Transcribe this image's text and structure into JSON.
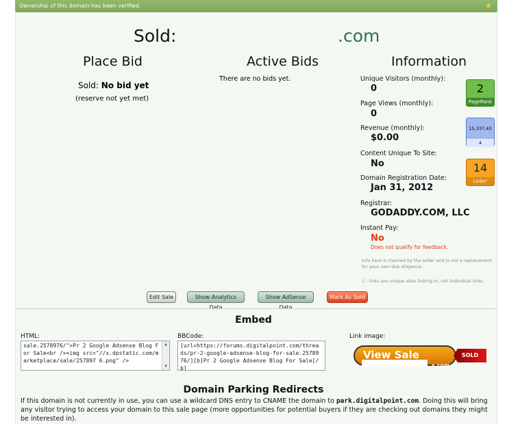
{
  "notice": "Ownership of this domain has been verified.",
  "title": {
    "label": "Sold:",
    "domain": ".com"
  },
  "place_bid": {
    "heading": "Place Bid",
    "status_prefix": "Sold:",
    "status_value": "No bid yet",
    "reserve": "(reserve not yet met)"
  },
  "active_bids": {
    "heading": "Active Bids",
    "empty": "There are no bids yet."
  },
  "information": {
    "heading": "Information",
    "rows": [
      {
        "label": "Unique Visitors (monthly):",
        "value": "0"
      },
      {
        "label": "Page Views (monthly):",
        "value": "0"
      },
      {
        "label": "Revenue (monthly):",
        "value": "$0.00"
      },
      {
        "label": "Content Unique To Site:",
        "value": "No"
      },
      {
        "label": "Domain Registration Date:",
        "value": "Jan 31, 2012"
      },
      {
        "label": "Registrar:",
        "value": "GODADDY.COM, LLC"
      },
      {
        "label": "Instant Pay:",
        "value": "No",
        "note": "Does not qualify for feedback."
      }
    ],
    "disclaimer": "Info here is claimed by the seller and is not a replacement for your own due diligence.",
    "footnote": "1 - links are unique sites linking in, not individual links."
  },
  "badges": {
    "pagerank": {
      "value": "2",
      "caption": "PageRank"
    },
    "alexa": {
      "value": "15,337,43",
      "caption": "4"
    },
    "links": {
      "value": "14",
      "caption": "Links¹"
    }
  },
  "buttons": {
    "edit": "Edit Sale",
    "analytics": "Show Analytics Data",
    "adsense": "Show AdSense Data",
    "mark_sold": "Mark As Sold"
  },
  "embed": {
    "heading": "Embed",
    "html_label": "HTML:",
    "html_code": "sale.2578976/\">Pr 2 Google Adsense Blog For Sale<br /><img src=\"//x.dpstatic.com/marketplace/sale/257897 6.png\" />",
    "bbcode_label": "BBCode:",
    "bbcode_code": "[url=https://forums.digitalpoint.com/threads/pr-2-google-adsense-blog-for-sale.2578976/][b]Pr 2 Google Adsense Blog For Sale[/b]",
    "link_label": "Link image:",
    "view_sale": "View Sale",
    "view_sale_domain": "s.com",
    "sold_tag": "SOLD"
  },
  "parking": {
    "heading": "Domain Parking Redirects",
    "text_before": "If this domain is not currently in use, you can use a wildcard DNS entry to CNAME the domain to ",
    "host": "park.digitalpoint.com",
    "text_after": ". Doing this will bring any visitor trying to access your domain to this sale page (more opportunities for potential buyers if they are checking out domains they might be interested in)."
  },
  "colors": {
    "accent_green": "#2f6e56",
    "alert_red": "#e03a12",
    "notice_bar": "#8cb463"
  }
}
